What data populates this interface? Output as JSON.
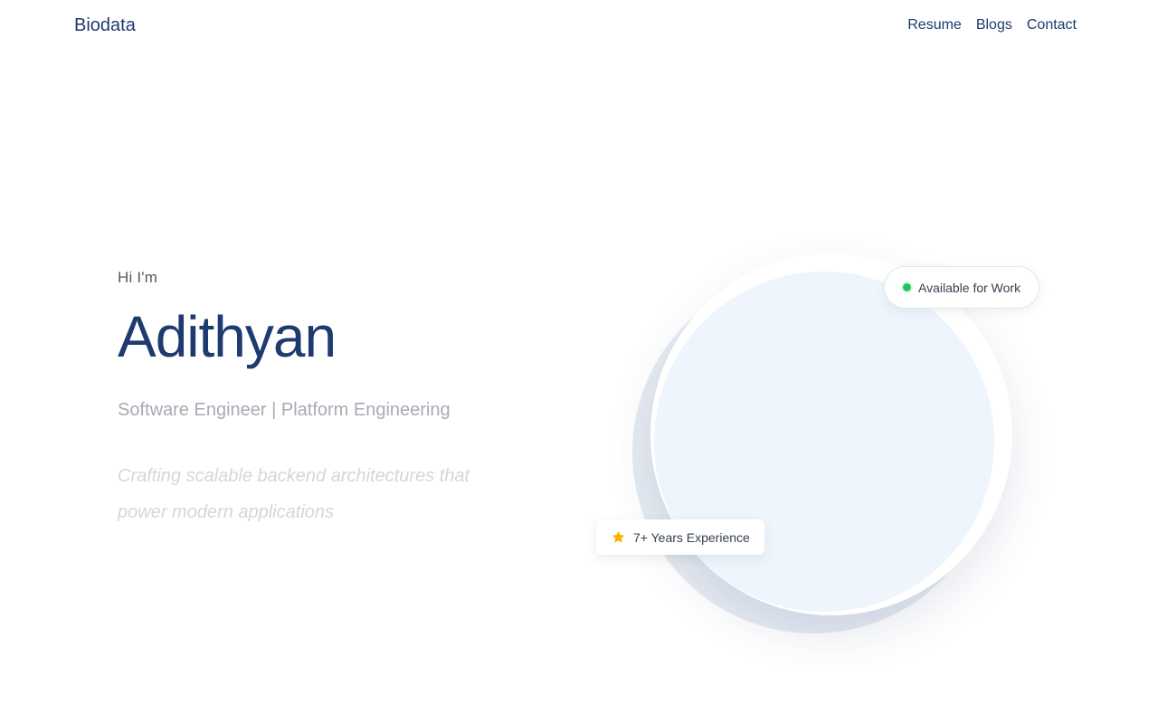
{
  "nav": {
    "brand": "Biodata",
    "links": [
      "Resume",
      "Blogs",
      "Contact"
    ]
  },
  "hero": {
    "greeting": "Hi I'm",
    "name": "Adithyan",
    "role": "Software Engineer | Platform Engineering",
    "tagline": "Crafting scalable backend architectures that power modern applications"
  },
  "badges": {
    "available": "Available for Work",
    "experience": "7+ Years Experience"
  },
  "icons": {
    "status_dot": "status-dot-icon",
    "star": "star-icon"
  },
  "colors": {
    "primary": "#1e3a6e",
    "available_dot": "#22c55e",
    "star": "#f5b301",
    "disc_fill": "#eff5fd"
  }
}
